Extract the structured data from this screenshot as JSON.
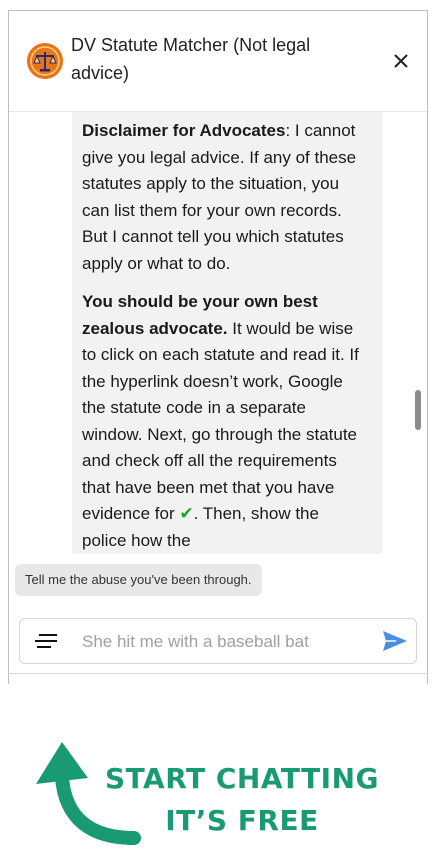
{
  "header": {
    "title": "DV Statute Matcher (Not legal advice)",
    "avatar_icon": "scales-of-justice-icon",
    "close_icon": "close-icon"
  },
  "message": {
    "p1_bold": "Disclaimer for Advocates",
    "p1_rest": ": I cannot give you legal advice. If any of these statutes apply to the situation, you can list them for your own records. But I cannot tell you which statutes apply or what to do.",
    "p2_bold": "You should be your own best zealous advocate.",
    "p2_rest": " It would be wise to click on each statute and read it. If the hyperlink doesn’t work, Google the statute code in a separate window. Next, go through the statute and check off all the requirements that have been met that you have evidence for ",
    "p2_check": "✔",
    "p2_tail": ". Then, show the police how the"
  },
  "prompt_chip": "Tell me the abuse you've been through.",
  "input": {
    "placeholder": "She hit me with a baseball bat",
    "menu_icon": "menu-icon",
    "send_icon": "send-icon"
  },
  "banner": {
    "line1": "START CHATTING",
    "line2": "IT’S FREE",
    "arrow_icon": "curved-arrow-icon",
    "color": "#1a9a72"
  }
}
